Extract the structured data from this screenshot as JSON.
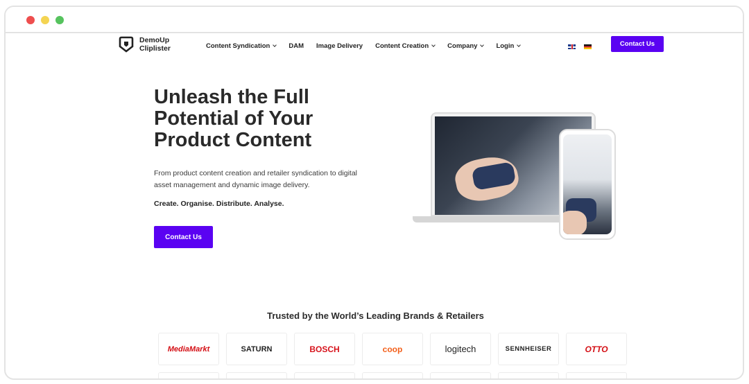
{
  "nav": {
    "logo_line1": "DemoUp",
    "logo_line2": "Cliplister",
    "items": [
      {
        "label": "Content Syndication",
        "dropdown": true
      },
      {
        "label": "DAM",
        "dropdown": false
      },
      {
        "label": "Image Delivery",
        "dropdown": false
      },
      {
        "label": "Content Creation",
        "dropdown": true
      },
      {
        "label": "Company",
        "dropdown": true
      },
      {
        "label": "Login",
        "dropdown": true
      }
    ],
    "cta": "Contact Us"
  },
  "hero": {
    "title": "Unleash the Full Potential of Your Product Content",
    "subtitle": "From product content creation and retailer syndication to digital asset management and dynamic image delivery.",
    "tagline": "Create. Organise. Distribute. Analyse.",
    "cta": "Contact Us"
  },
  "trusted": {
    "heading": "Trusted by the World’s Leading Brands & Retailers",
    "brands": [
      {
        "name": "MediaMarkt",
        "color": "#d40e14"
      },
      {
        "name": "SATURN",
        "color": "#222222"
      },
      {
        "name": "BOSCH",
        "color": "#d7121b"
      },
      {
        "name": "coop",
        "color": "#f3601b"
      },
      {
        "name": "logitech",
        "color": "#222222"
      },
      {
        "name": "SENNHEISER",
        "color": "#222222"
      },
      {
        "name": "OTTO",
        "color": "#d40e14"
      }
    ]
  },
  "colors": {
    "accent": "#5a02f2"
  }
}
